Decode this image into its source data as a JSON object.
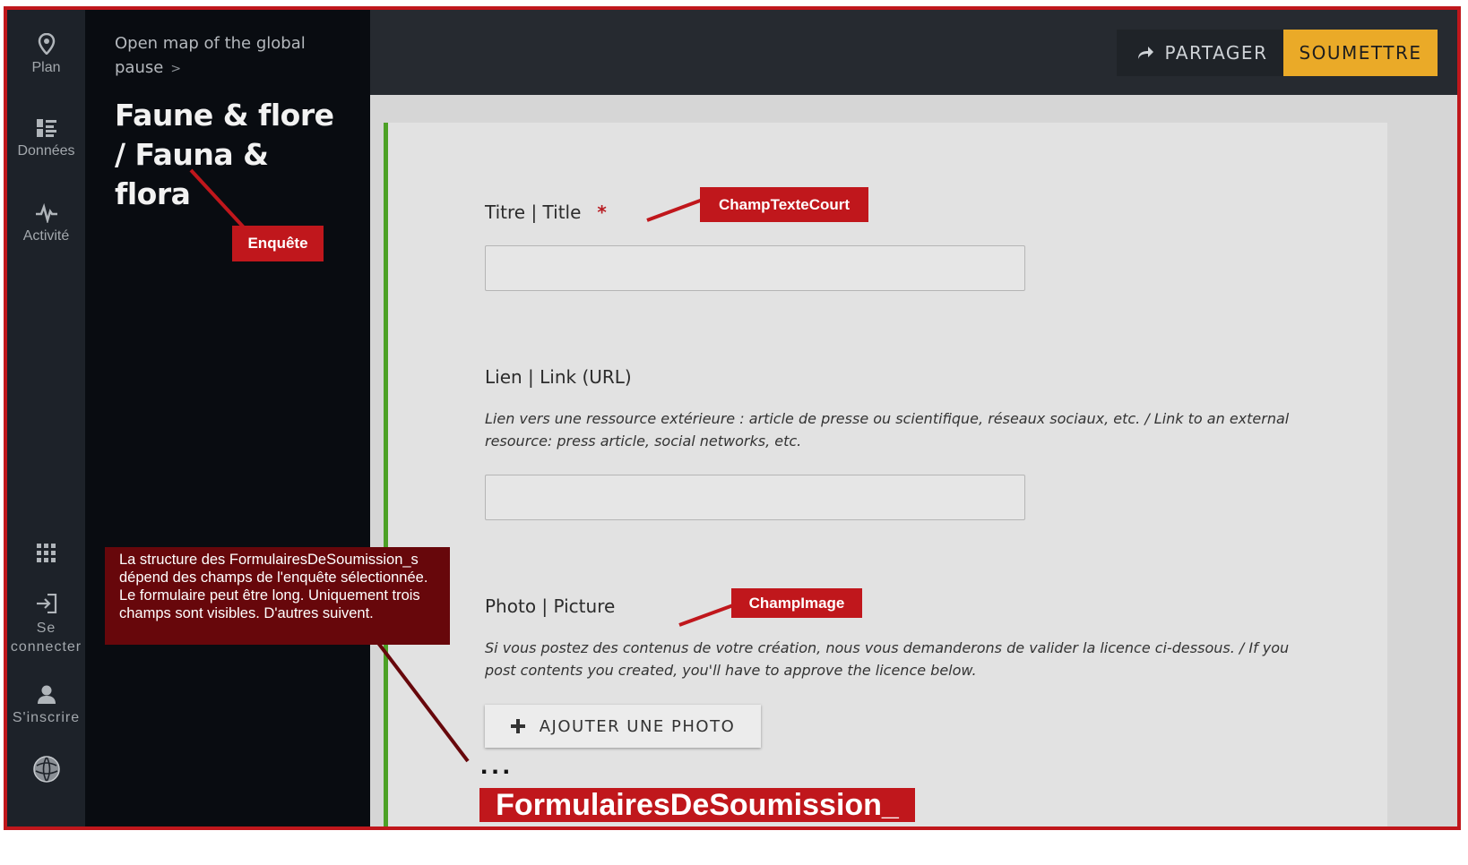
{
  "rail": {
    "items": [
      {
        "label": "Plan",
        "icon": "map-pin-icon"
      },
      {
        "label": "Données",
        "icon": "data-list-icon"
      },
      {
        "label": "Activité",
        "icon": "activity-pulse-icon"
      }
    ],
    "bottom_items": [
      {
        "label": "",
        "icon": "apps-grid-icon"
      },
      {
        "label": "Se\nconnecter",
        "icon": "login-icon"
      },
      {
        "label": "S'inscrire",
        "icon": "user-icon"
      },
      {
        "label": "",
        "icon": "globe-logo-icon"
      }
    ]
  },
  "panel": {
    "breadcrumb": "Open map of the global pause",
    "breadcrumb_sep": ">",
    "survey_title": "Faune & flore / Fauna & flora"
  },
  "topbar": {
    "share_label": "PARTAGER",
    "share_icon": "share-arrow-icon",
    "submit_label": "SOUMETTRE",
    "submit_color": "#eaaa28"
  },
  "form": {
    "accent_color": "#4da126",
    "fields": [
      {
        "label": "Titre | Title",
        "required_mark": "*",
        "value": ""
      },
      {
        "label": "Lien | Link (URL)",
        "help": "Lien vers une ressource extérieure : article de presse ou scientifique, réseaux sociaux, etc. / Link to an external resource: press article, social networks, etc.",
        "value": ""
      },
      {
        "label": "Photo | Picture",
        "help": "Si vous postez des contenus de votre création, nous vous demanderons de valider la licence ci-dessous. / If you post contents you created, you'll have to approve the licence below.",
        "button_label": "AJOUTER UNE PHOTO"
      }
    ],
    "ellipsis": "..."
  },
  "annotations": {
    "enquete": "Enquête",
    "champ_texte_court": "ChampTexteCourt",
    "champ_image": "ChampImage",
    "note": "La structure des FormulairesDeSoumission_s dépend des champs de l'enquête sélectionnée. Le formulaire peut être long. Uniquement trois champs sont visibles. D'autres suivent.",
    "formulaires": "FormulairesDeSoumission_",
    "annotation_color": "#c0171c"
  }
}
